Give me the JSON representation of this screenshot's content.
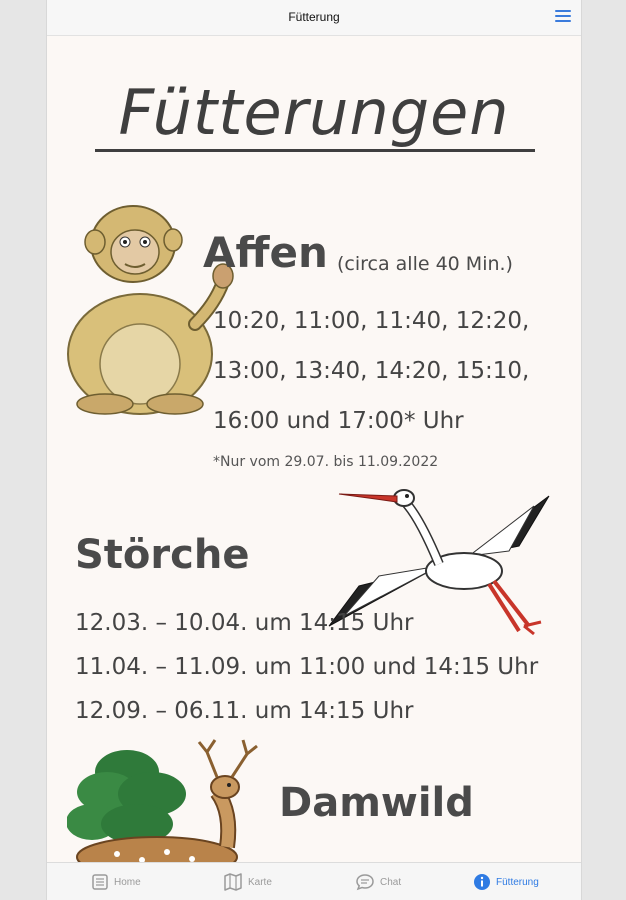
{
  "navbar": {
    "title": "Fütterung"
  },
  "page": {
    "headline": "Fütterungen",
    "affen": {
      "title": "Affen",
      "note": "(circa alle 40 Min.)",
      "times": [
        "10:20, 11:00, 11:40, 12:20,",
        "13:00, 13:40, 14:20, 15:10,",
        "16:00 und 17:00* Uhr"
      ],
      "footnote": "*Nur vom 29.07. bis 11.09.2022"
    },
    "stoerche": {
      "title": "Störche",
      "times": [
        "12.03. – 10.04. um 14:15 Uhr",
        "11.04. – 11.09. um 11:00 und 14:15 Uhr",
        "12.09. – 06.11. um 14:15 Uhr"
      ]
    },
    "damwild": {
      "title": "Damwild"
    }
  },
  "tabs": [
    {
      "label": "Home",
      "icon": "book-icon"
    },
    {
      "label": "Karte",
      "icon": "map-icon"
    },
    {
      "label": "Chat",
      "icon": "chat-bubble-icon"
    },
    {
      "label": "Fütterung",
      "icon": "info-icon",
      "active": true
    }
  ],
  "colors": {
    "accent": "#2f7be3",
    "text": "#444444",
    "background": "#fcf8f5"
  }
}
